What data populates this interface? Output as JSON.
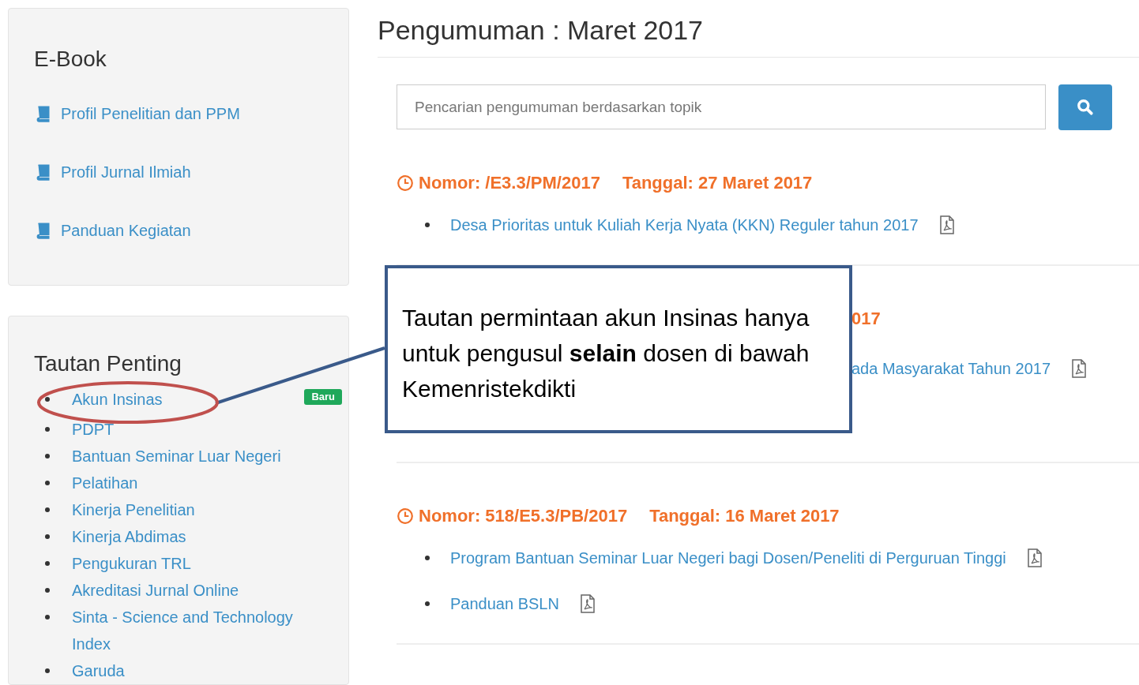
{
  "sidebar": {
    "ebook": {
      "title": "E-Book",
      "items": [
        {
          "label": "Profil Penelitian dan PPM"
        },
        {
          "label": "Profil Jurnal Ilmiah"
        },
        {
          "label": "Panduan Kegiatan"
        }
      ]
    },
    "links": {
      "title": "Tautan Penting",
      "items": [
        {
          "label": "Akun Insinas",
          "badge": "Baru"
        },
        {
          "label": "PDPT"
        },
        {
          "label": "Bantuan Seminar Luar Negeri"
        },
        {
          "label": "Pelatihan"
        },
        {
          "label": "Kinerja Penelitian"
        },
        {
          "label": "Kinerja Abdimas"
        },
        {
          "label": "Pengukuran TRL"
        },
        {
          "label": "Akreditasi Jurnal Online"
        },
        {
          "label": "Sinta - Science and Technology Index"
        },
        {
          "label": "Garuda"
        }
      ]
    }
  },
  "main": {
    "title": "Pengumuman : Maret 2017",
    "search": {
      "placeholder": "Pencarian pengumuman berdasarkan topik"
    },
    "announcements": [
      {
        "covered": false,
        "number": "Nomor: /E3.3/PM/2017",
        "date": "Tanggal: 27 Maret 2017",
        "documents": [
          "Desa Prioritas untuk Kuliah Kerja Nyata (KKN) Reguler tahun 2017"
        ]
      },
      {
        "covered": true,
        "number": "017",
        "documents": [
          "ada Masyarakat Tahun 2017"
        ]
      },
      {
        "covered": false,
        "number": "Nomor: 518/E5.3/PB/2017",
        "date": "Tanggal: 16 Maret 2017",
        "documents": [
          "Program Bantuan Seminar Luar Negeri bagi Dosen/Peneliti di Perguruan Tinggi",
          "Panduan BSLN"
        ]
      }
    ]
  },
  "annotation": {
    "text": "Tautan permintaan akun Insinas hanya untuk pengusul **selain** dosen di bawah Kemenristekdikti"
  }
}
